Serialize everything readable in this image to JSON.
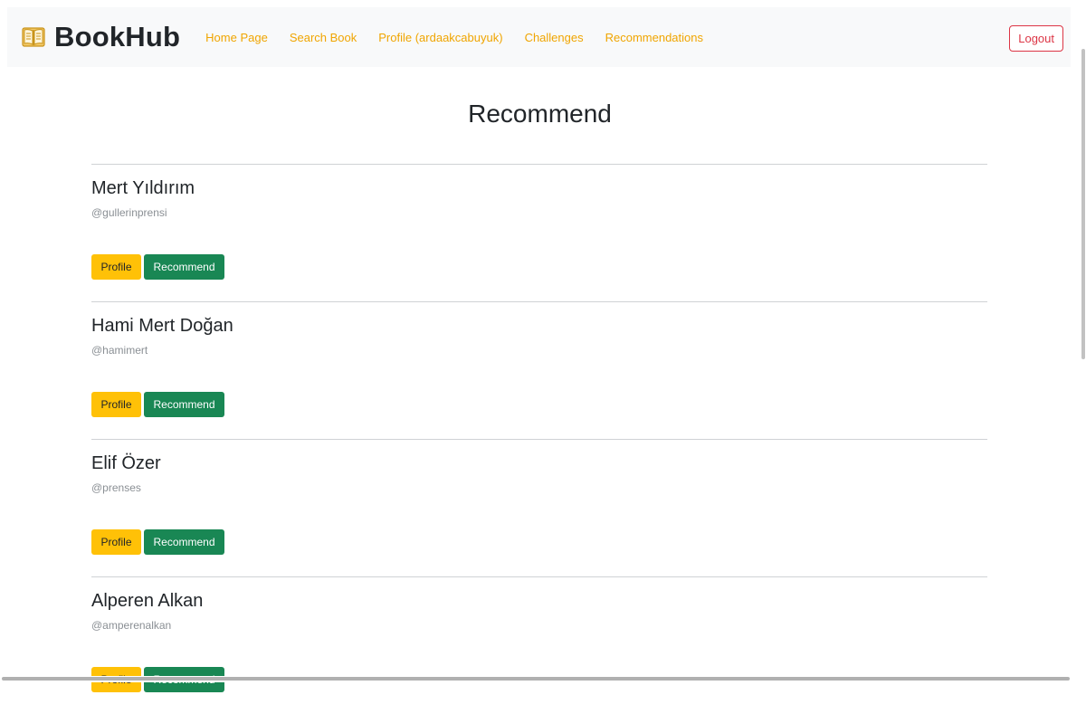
{
  "navbar": {
    "brand": "BookHub",
    "brand_icon": "open-book-icon",
    "links": [
      {
        "label": "Home Page"
      },
      {
        "label": "Search Book"
      },
      {
        "label": "Profile (ardaakcabuyuk)"
      },
      {
        "label": "Challenges"
      },
      {
        "label": "Recommendations"
      }
    ],
    "logout_label": "Logout",
    "link_color": "#f0a500",
    "logout_color": "#dc3545"
  },
  "page": {
    "title": "Recommend"
  },
  "users": [
    {
      "name": "Mert Yıldırım",
      "handle": "@gullerinprensi",
      "profile_label": "Profile",
      "recommend_label": "Recommend"
    },
    {
      "name": "Hami Mert Doğan",
      "handle": "@hamimert",
      "profile_label": "Profile",
      "recommend_label": "Recommend"
    },
    {
      "name": "Elif Özer",
      "handle": "@prenses",
      "profile_label": "Profile",
      "recommend_label": "Recommend"
    },
    {
      "name": "Alperen Alkan",
      "handle": "@amperenalkan",
      "profile_label": "Profile",
      "recommend_label": "Recommend"
    }
  ],
  "colors": {
    "profile_button": "#ffc107",
    "recommend_button": "#198754"
  }
}
